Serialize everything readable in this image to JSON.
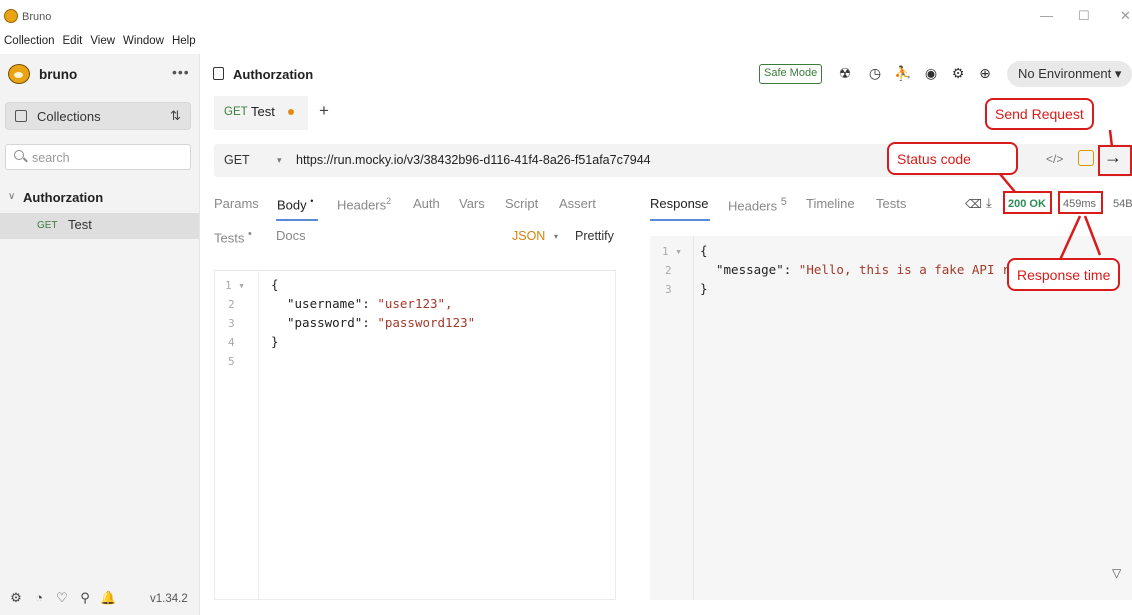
{
  "window": {
    "title": "Bruno",
    "minimize": "—",
    "maximize": "☐",
    "close": "✕"
  },
  "menu": [
    "Collection",
    "Edit",
    "View",
    "Window",
    "Help"
  ],
  "sidebar": {
    "brand": "bruno",
    "more": "•••",
    "collections_label": "Collections",
    "sort_glyph": "⇅",
    "search_placeholder": "search",
    "collection_chevron": "∨",
    "collection_name": "Authorzation",
    "request": {
      "method": "GET",
      "name": "Test"
    },
    "footer_icons": [
      "⚙",
      "◔",
      "♡",
      "⚲",
      "🔔"
    ],
    "version": "v1.34.2"
  },
  "topbar": {
    "collection_title": "Authorzation",
    "safe_mode": "Safe Mode",
    "icons": [
      "☢",
      "◷",
      "⛹",
      "◉",
      "⚙",
      "⊕"
    ],
    "environment": "No Environment ▾"
  },
  "request_tab": {
    "method": "GET",
    "name": "Test",
    "new_tab": "+"
  },
  "url_bar": {
    "method": "GET",
    "caret": "▾",
    "url": "https://run.mocky.io/v3/38432b96-d116-41f4-8a26-f51afa7c7944",
    "code_glyph": "</>",
    "send_glyph": "→"
  },
  "request_pane": {
    "tabs": [
      {
        "label": "Params",
        "sup": ""
      },
      {
        "label": "Body",
        "sup": "•"
      },
      {
        "label": "Headers",
        "sup": "2"
      },
      {
        "label": "Auth",
        "sup": ""
      },
      {
        "label": "Vars",
        "sup": ""
      },
      {
        "label": "Script",
        "sup": ""
      },
      {
        "label": "Assert",
        "sup": ""
      }
    ],
    "tabs_row2": [
      {
        "label": "Tests",
        "sup": "•"
      },
      {
        "label": "Docs",
        "sup": ""
      }
    ],
    "mode": "JSON",
    "mode_caret": "▾",
    "prettify": "Prettify",
    "line_numbers": [
      "1 ▾",
      "2",
      "3",
      "4",
      "5"
    ],
    "code": [
      {
        "key": "{",
        "val": ""
      },
      {
        "key": "\"username\": ",
        "val": "\"user123\","
      },
      {
        "key": "\"password\": ",
        "val": "\"password123\""
      },
      {
        "key": "}",
        "val": ""
      }
    ]
  },
  "response_pane": {
    "tabs": [
      {
        "label": "Response",
        "sup": ""
      },
      {
        "label": "Headers",
        "sup": "5"
      },
      {
        "label": "Timeline",
        "sup": ""
      },
      {
        "label": "Tests",
        "sup": ""
      }
    ],
    "eraser_glyph": "⌫",
    "download_glyph": "⤓",
    "status": "200 OK",
    "time": "459ms",
    "size": "54B",
    "line_numbers": [
      "1 ▾",
      "2",
      "3"
    ],
    "code": [
      {
        "key": "{",
        "val": ""
      },
      {
        "key": "\"message\": ",
        "val": "\"Hello, this is a fake API response\""
      },
      {
        "key": "}",
        "val": ""
      }
    ],
    "filter_glyph": "▽"
  },
  "annotations": {
    "send_request": "Send Request",
    "status_code": "Status code",
    "response_time": "Response time",
    "color": "#d81b1b"
  }
}
